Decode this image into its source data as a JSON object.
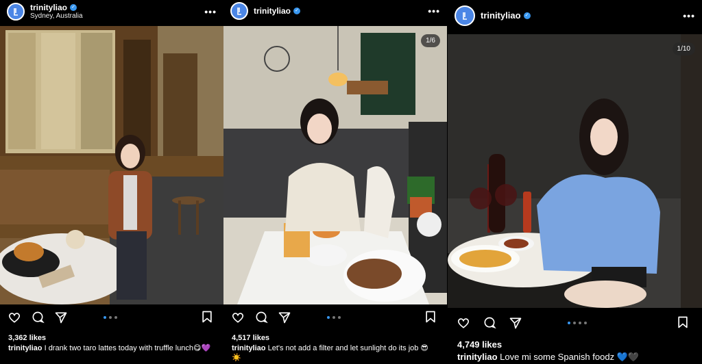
{
  "posts": [
    {
      "username": "trinityliao",
      "location": "Sydney, Australia",
      "counter": "",
      "likes": "3,362 likes",
      "caption_user": "trinityliao",
      "caption_text": "I drank two taro lattes today with truffle lunch😋💜"
    },
    {
      "username": "trinityliao",
      "location": "",
      "counter": "1/6",
      "likes": "4,517 likes",
      "caption_user": "trinityliao",
      "caption_text": "Let's not add a filter and let sunlight do its job 😎☀️"
    },
    {
      "username": "trinityliao",
      "location": "",
      "counter": "1/10",
      "likes": "4,749 likes",
      "caption_user": "trinityliao",
      "caption_text": "Love mi some Spanish foodz 💙🖤"
    }
  ],
  "icons": {
    "more": "more-options-icon",
    "like": "heart-icon",
    "comment": "comment-icon",
    "share": "share-icon",
    "save": "bookmark-icon",
    "verified": "verified-icon"
  },
  "colors": {
    "accent": "#3897f0",
    "background": "#000000"
  }
}
